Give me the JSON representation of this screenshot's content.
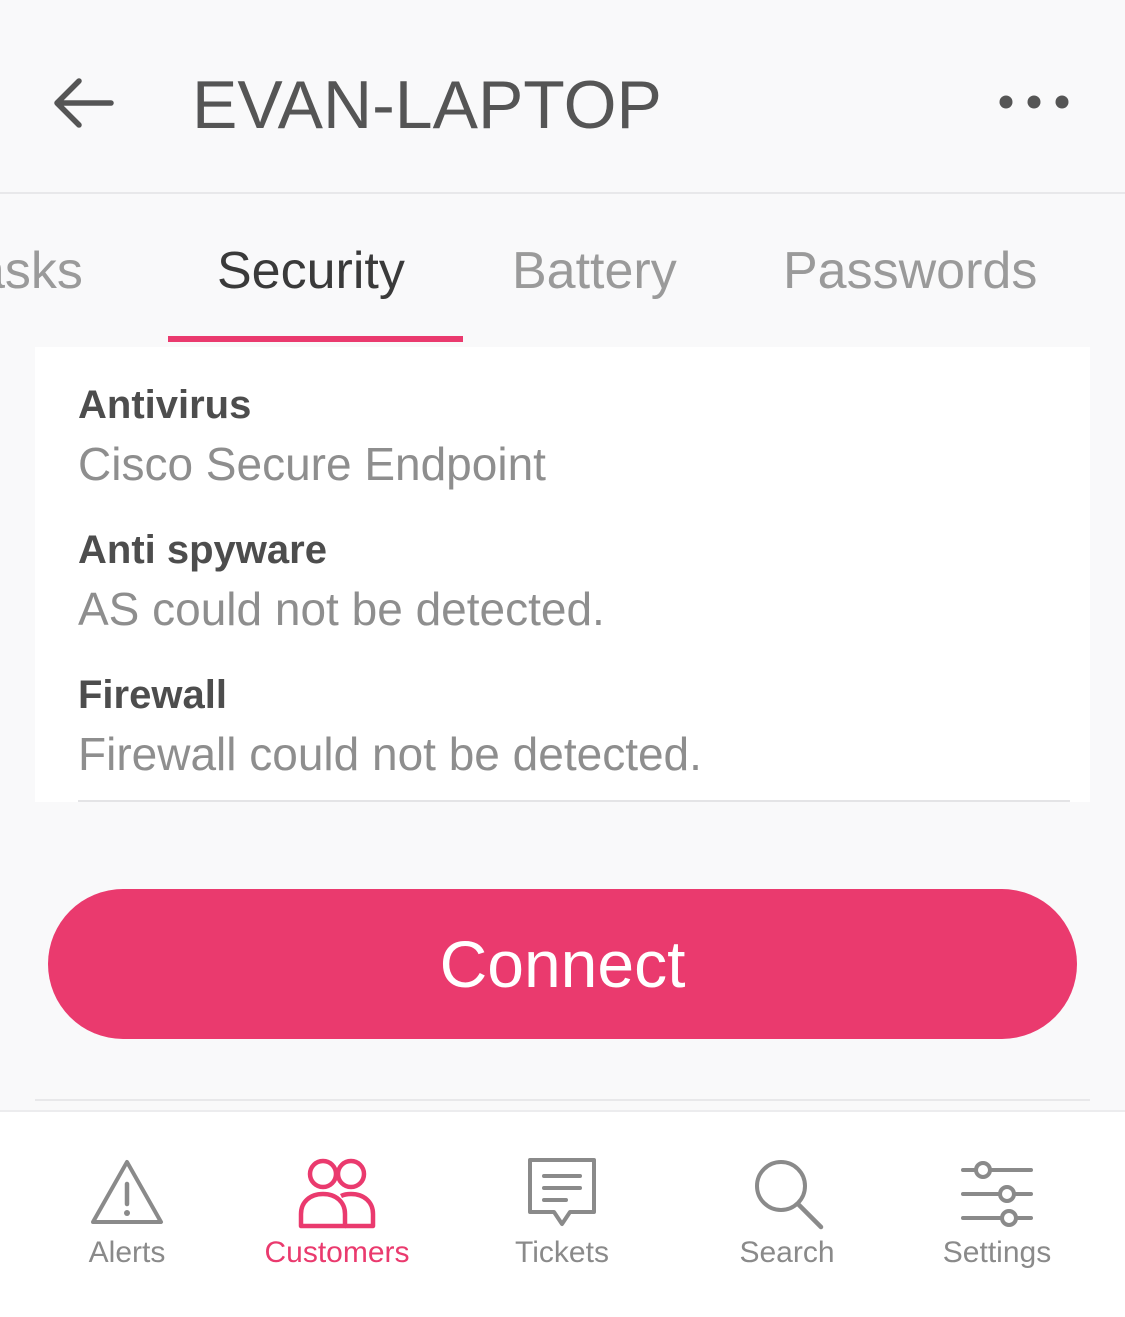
{
  "header": {
    "title": "EVAN-LAPTOP",
    "back_icon": "back-arrow-icon",
    "more_icon": "more-horizontal-icon"
  },
  "tabs": [
    {
      "label": "Tasks",
      "visible_text": "sks",
      "active": false
    },
    {
      "label": "Security",
      "active": true
    },
    {
      "label": "Battery",
      "active": false
    },
    {
      "label": "Passwords",
      "active": false
    }
  ],
  "security": {
    "fields": [
      {
        "label": "Antivirus",
        "value": "Cisco Secure Endpoint"
      },
      {
        "label": "Anti spyware",
        "value": "AS could not be detected."
      },
      {
        "label": "Firewall",
        "value": "Firewall could not be detected."
      }
    ]
  },
  "connect_button": {
    "label": "Connect"
  },
  "tabbar": {
    "items": [
      {
        "label": "Alerts",
        "icon": "warning-triangle-icon",
        "active": false
      },
      {
        "label": "Customers",
        "icon": "users-icon",
        "active": true
      },
      {
        "label": "Tickets",
        "icon": "message-square-icon",
        "active": false
      },
      {
        "label": "Search",
        "icon": "search-icon",
        "active": false
      },
      {
        "label": "Settings",
        "icon": "sliders-icon",
        "active": false
      }
    ]
  },
  "colors": {
    "accent": "#ea3a6e",
    "title_text": "#555555",
    "muted_text": "#8e8e8e",
    "background": "#f9f9fa"
  }
}
